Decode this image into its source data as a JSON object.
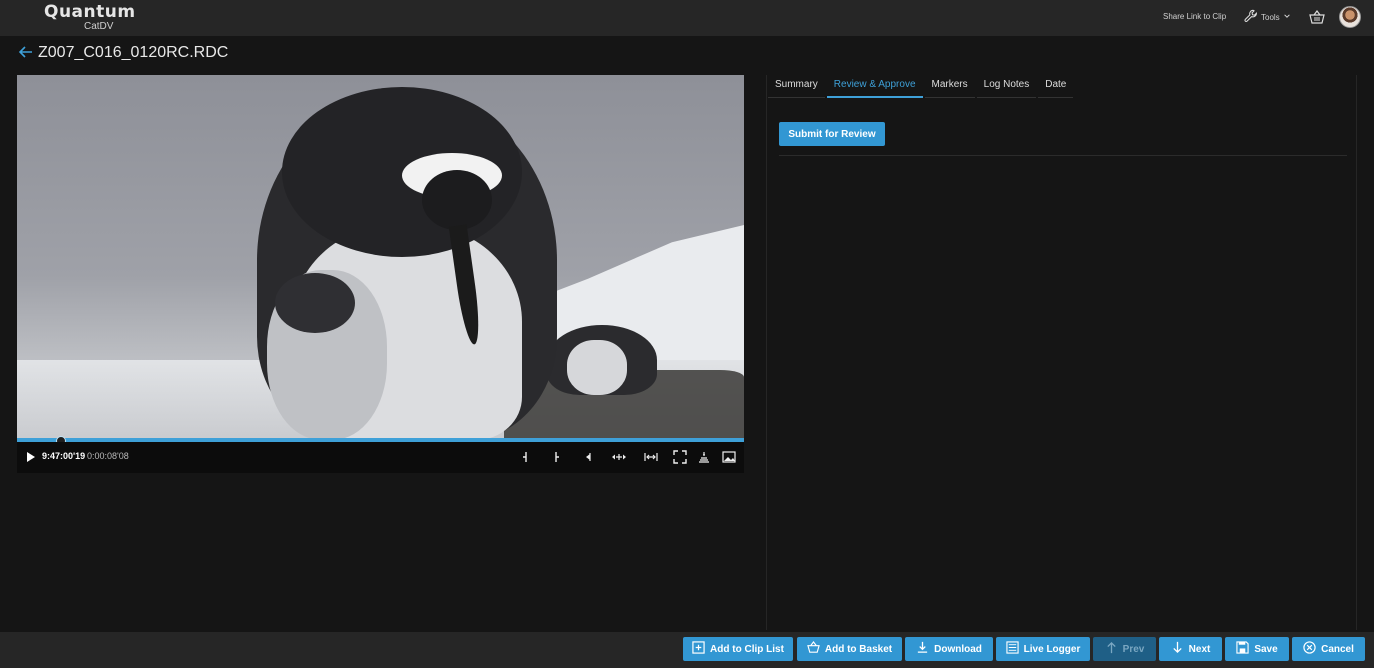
{
  "header": {
    "logo_brand": "Quantum",
    "logo_sub": "CatDV",
    "share_link": "Share Link to Clip",
    "tools": "Tools"
  },
  "clip": {
    "title": "Z007_C016_0120RC.RDC"
  },
  "player": {
    "timecode": "9:47:00'19",
    "position": "0:00:08'08",
    "progress": 0.06
  },
  "tabs": [
    {
      "label": "Summary",
      "active": false
    },
    {
      "label": "Review & Approve",
      "active": true
    },
    {
      "label": "Markers",
      "active": false
    },
    {
      "label": "Log Notes",
      "active": false
    },
    {
      "label": "Date",
      "active": false
    }
  ],
  "review": {
    "submit_label": "Submit for Review"
  },
  "footer": {
    "add_to_clip_list": "Add to Clip List",
    "add_to_basket": "Add to Basket",
    "download": "Download",
    "live_logger": "Live Logger",
    "prev": "Prev",
    "next": "Next",
    "save": "Save",
    "cancel": "Cancel"
  },
  "colors": {
    "accent": "#3297d3",
    "background": "#151515",
    "bar": "#262626"
  }
}
